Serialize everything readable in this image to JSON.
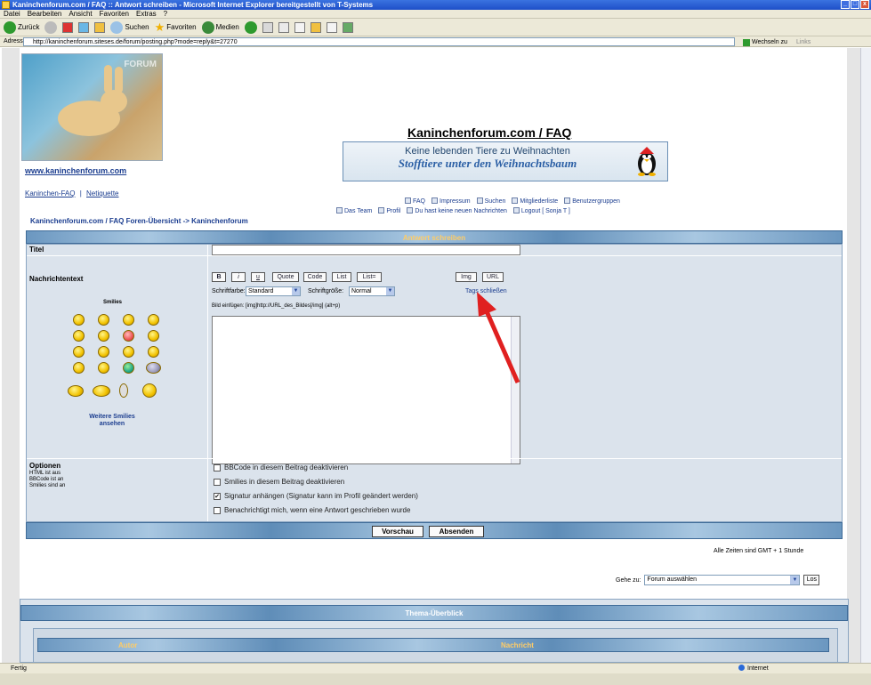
{
  "window": {
    "title": "Kaninchenforum.com / FAQ :: Antwort schreiben - Microsoft Internet Explorer bereitgestellt von T-Systems"
  },
  "menu": [
    "Datei",
    "Bearbeiten",
    "Ansicht",
    "Favoriten",
    "Extras",
    "?"
  ],
  "toolbar": {
    "back": "Zurück",
    "search": "Suchen",
    "favorites": "Favoriten",
    "media": "Medien"
  },
  "address": {
    "label": "Adresse",
    "url": "http://kaninchenforum.siteses.de/forum/posting.php?mode=reply&t=27270",
    "go_label": "Wechseln zu",
    "links_label": "Links"
  },
  "header": {
    "site_link": "www.kaninchenforum.com",
    "faq_link": "Kaninchen-FAQ",
    "netiquette_link": "Netiquette",
    "site_title": "Kaninchenforum.com / FAQ",
    "banner_line1": "Keine lebenden Tiere zu Weihnachten",
    "banner_line2": "Stofftiere unter den Weihnachtsbaum",
    "logo_text": "FORUM"
  },
  "nav": {
    "row1": [
      "FAQ",
      "Impressum",
      "Suchen",
      "Mitgliederliste",
      "Benutzergruppen"
    ],
    "row2": [
      "Das Team",
      "Profil",
      "Du hast keine neuen Nachrichten",
      "Logout [ Sonja T ]"
    ]
  },
  "breadcrumb": "Kaninchenforum.com / FAQ Foren-Übersicht -> Kaninchenforum",
  "form": {
    "header": "Antwort schreiben",
    "title_label": "Titel",
    "message_label": "Nachrichtentext",
    "smilies_label": "Smilies",
    "more_smilies": "Weitere Smilies ansehen",
    "bbcode_buttons": [
      "B",
      "i",
      "u",
      "Quote",
      "Code",
      "List",
      "List=",
      "Img",
      "URL"
    ],
    "font_color_label": "Schriftfarbe:",
    "font_color_value": "Standard",
    "font_size_label": "Schriftgröße:",
    "font_size_value": "Normal",
    "close_tags": "Tags schließen",
    "help_line": "Bild einfügen: [img]http://URL_des_Bildes[/img] (alt+p)",
    "options_label": "Optionen",
    "options_info": [
      "HTML ist aus",
      "BBCode ist an",
      "Smilies sind an"
    ],
    "checkboxes": [
      {
        "label": "BBCode in diesem Beitrag deaktivieren",
        "checked": ""
      },
      {
        "label": "Smilies in diesem Beitrag deaktivieren",
        "checked": ""
      },
      {
        "label": "Signatur anhängen (Signatur kann im Profil geändert werden)",
        "checked": "✔"
      },
      {
        "label": "Benachrichtigt mich, wenn eine Antwort geschrieben wurde",
        "checked": ""
      }
    ],
    "preview_button": "Vorschau",
    "submit_button": "Absenden"
  },
  "timezone": "Alle Zeiten sind GMT + 1 Stunde",
  "goto": {
    "label": "Gehe zu:",
    "value": "Forum auswählen",
    "button": "Los"
  },
  "overview": {
    "title": "Thema-Überblick",
    "col_author": "Autor",
    "col_message": "Nachricht"
  },
  "status": {
    "left": "Fertig",
    "zone": "Internet"
  },
  "colors": {
    "accent": "#1b3d8f",
    "header_text": "#ffcc66",
    "arrow": "#e02020"
  }
}
